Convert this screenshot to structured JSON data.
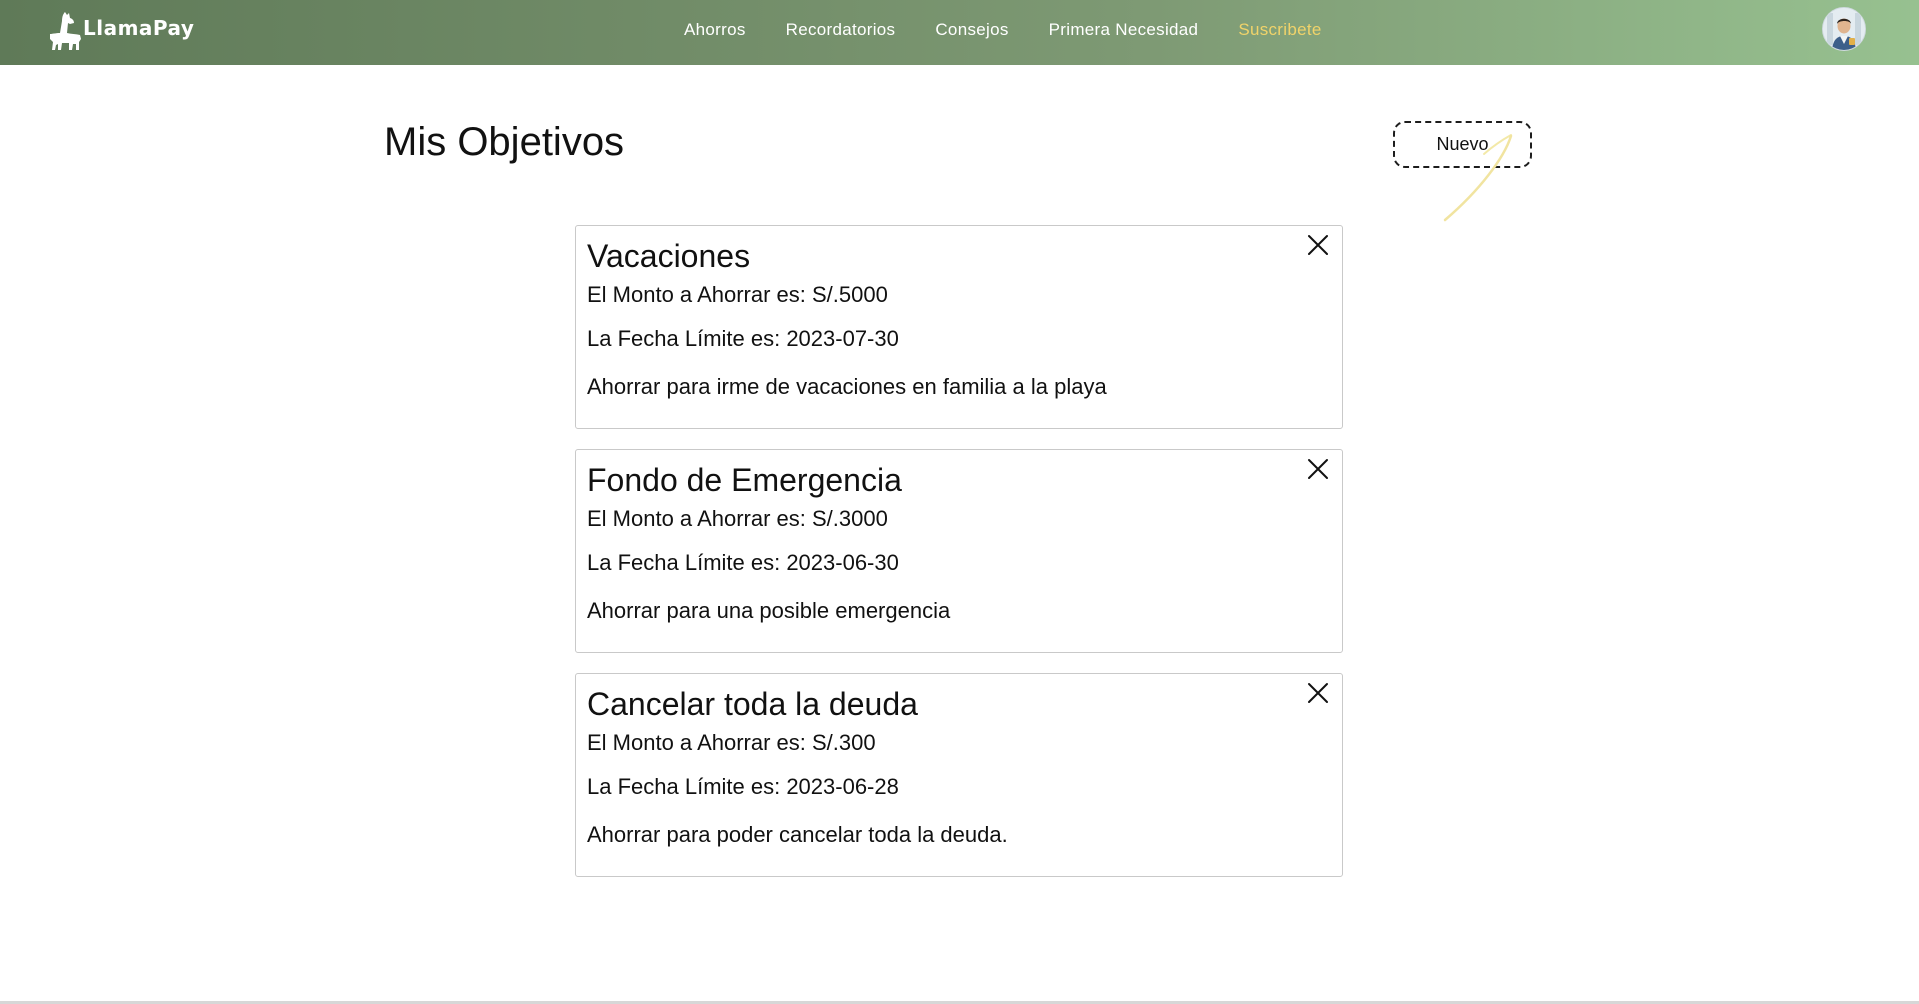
{
  "brand": {
    "name": "LlamaPay"
  },
  "nav": {
    "items": [
      {
        "label": "Ahorros"
      },
      {
        "label": "Recordatorios"
      },
      {
        "label": "Consejos"
      },
      {
        "label": "Primera Necesidad"
      },
      {
        "label": "Suscribete"
      }
    ],
    "accent_color": "#f0d36a"
  },
  "page": {
    "title": "Mis Objetivos",
    "new_button_label": "Nuevo"
  },
  "goals": [
    {
      "title": "Vacaciones",
      "amount_line": "El Monto a Ahorrar es: S/.5000",
      "date_line": "La Fecha Límite es: 2023-07-30",
      "description": "Ahorrar para irme de vacaciones en familia a la playa"
    },
    {
      "title": "Fondo de Emergencia",
      "amount_line": "El Monto a Ahorrar es: S/.3000",
      "date_line": "La Fecha Límite es: 2023-06-30",
      "description": "Ahorrar para una posible emergencia"
    },
    {
      "title": "Cancelar toda la deuda",
      "amount_line": "El Monto a Ahorrar es: S/.300",
      "date_line": "La Fecha Límite es: 2023-06-28",
      "description": "Ahorrar para poder cancelar toda la deuda."
    }
  ],
  "icons": {
    "brand": "llama-icon",
    "avatar": "user-avatar",
    "close": "close-icon"
  },
  "colors": {
    "navbar_start": "#5f7a58",
    "navbar_end": "#97c190"
  }
}
